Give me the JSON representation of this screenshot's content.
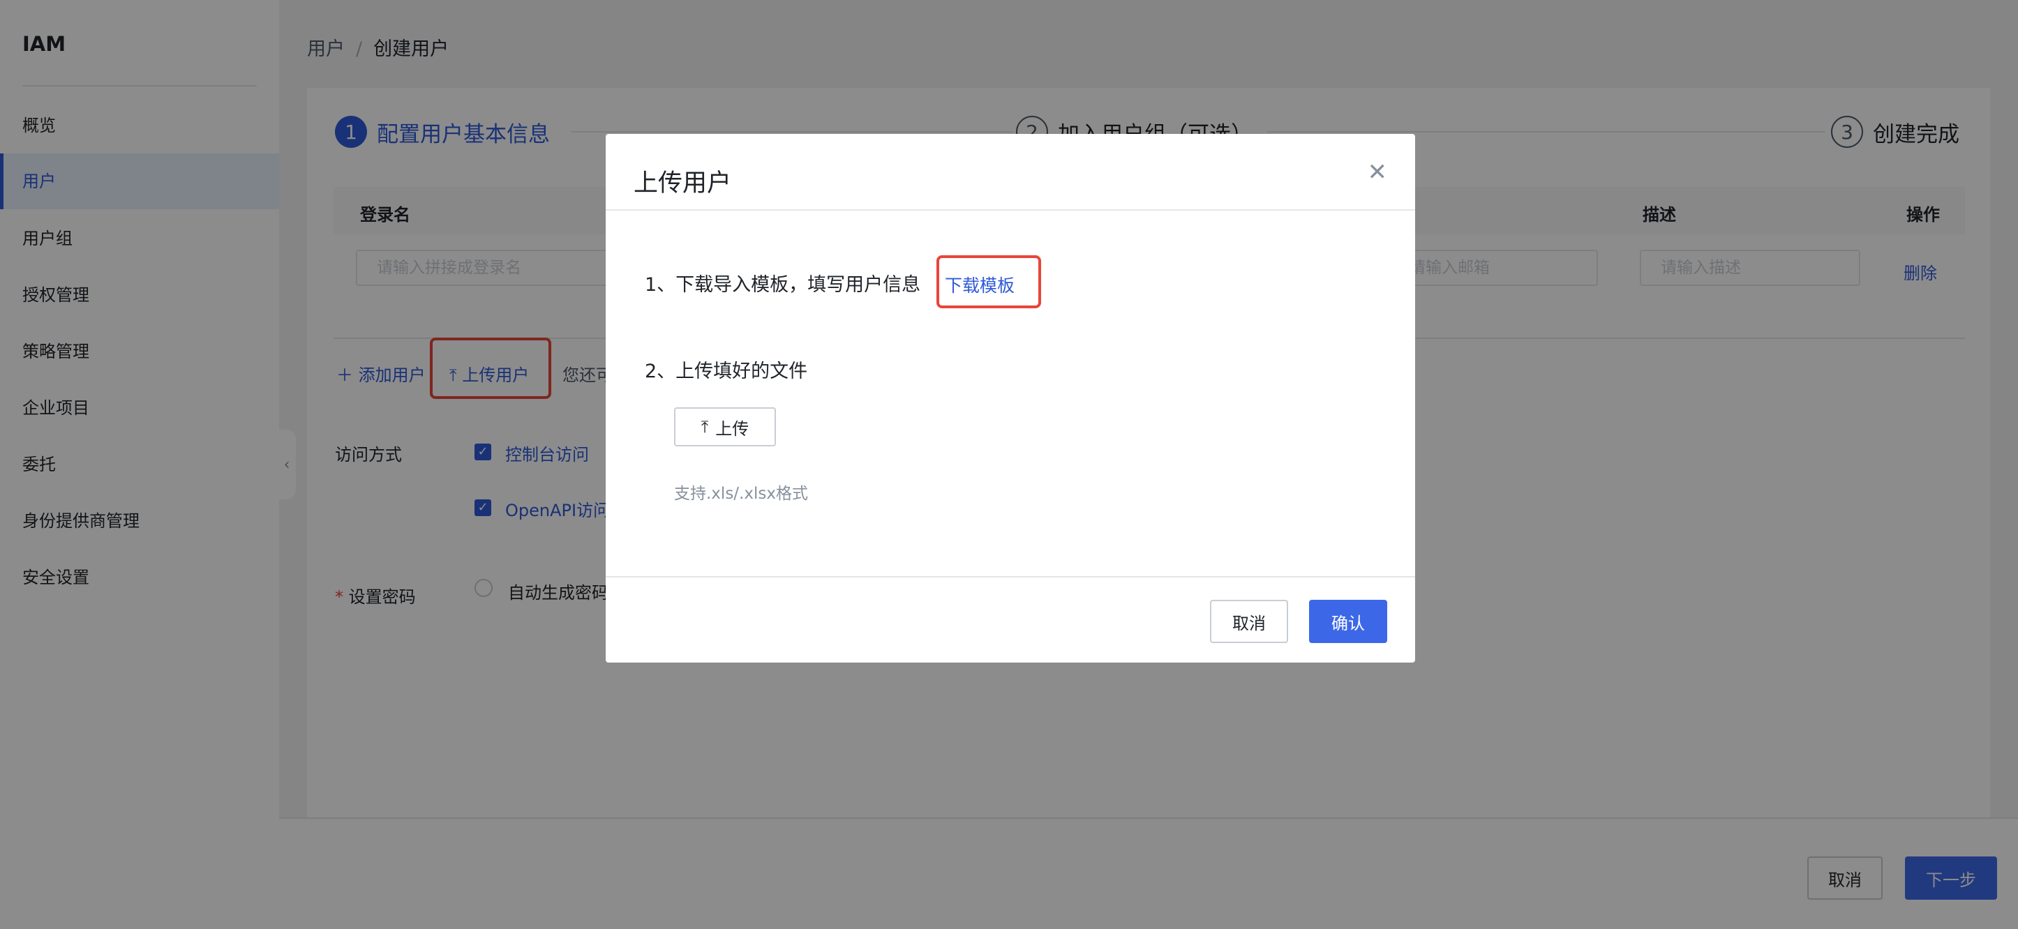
{
  "app": {
    "title": "IAM"
  },
  "sidebar": {
    "items": [
      {
        "label": "概览"
      },
      {
        "label": "用户",
        "active": true
      },
      {
        "label": "用户组"
      },
      {
        "label": "授权管理"
      },
      {
        "label": "策略管理"
      },
      {
        "label": "企业项目"
      },
      {
        "label": "委托"
      },
      {
        "label": "身份提供商管理"
      },
      {
        "label": "安全设置"
      }
    ]
  },
  "breadcrumb": {
    "parent": "用户",
    "separator": "/",
    "current": "创建用户"
  },
  "steps": [
    {
      "number": "1",
      "label": "配置用户基本信息",
      "state": "active"
    },
    {
      "number": "2",
      "label": "加入用户组（可选）",
      "state": "pending"
    },
    {
      "number": "3",
      "label": "创建完成",
      "state": "pending"
    }
  ],
  "table": {
    "headers": {
      "login_name": "登录名",
      "description": "描述",
      "operation": "操作"
    },
    "row": {
      "login_placeholder": "请输入拼接成登录名",
      "email_placeholder": "请输入邮箱",
      "description_placeholder": "请输入描述",
      "delete_label": "删除"
    }
  },
  "actions": {
    "add_user": "添加用户",
    "upload_user": "上传用户",
    "hint_text": "您还可"
  },
  "access": {
    "label": "访问方式",
    "console": "控制台访问",
    "openapi": "OpenAPI访问"
  },
  "password": {
    "required_mark": "*",
    "label": "设置密码",
    "auto_generate": "自动生成密码"
  },
  "footer": {
    "cancel": "取消",
    "next": "下一步"
  },
  "modal": {
    "title": "上传用户",
    "step1_text": "1、下载导入模板，填写用户信息",
    "download_link": "下载模板",
    "step2_text": "2、上传填好的文件",
    "upload_button": "上传",
    "format_hint": "支持.xls/.xlsx格式",
    "cancel": "取消",
    "confirm": "确认"
  },
  "colors": {
    "accent": "#2f5ad8",
    "primary_button": "#3c68e8",
    "highlight": "#e8463a"
  }
}
